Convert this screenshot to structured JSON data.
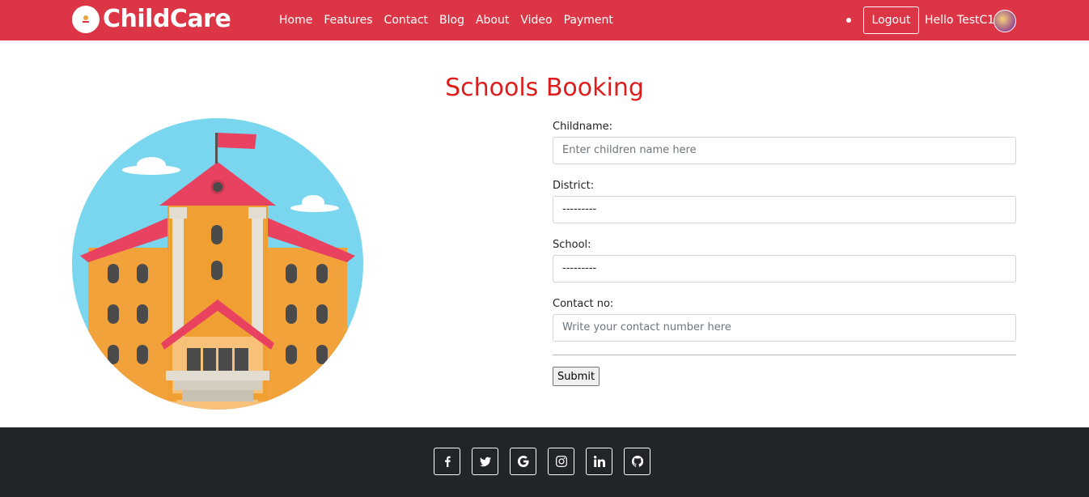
{
  "navbar": {
    "brand": "ChildCare",
    "links": [
      "Home",
      "Features",
      "Contact",
      "Blog",
      "About",
      "Video",
      "Payment"
    ],
    "logout_label": "Logout",
    "greeting": "Hello TestC1"
  },
  "main": {
    "title": "Schools Booking",
    "form": {
      "childname_label": "Childname:",
      "childname_placeholder": "Enter children name here",
      "district_label": "District:",
      "district_value": "---------",
      "school_label": "School:",
      "school_value": "---------",
      "contact_label": "Contact no:",
      "contact_placeholder": "Write your contact number here",
      "submit_label": "Submit"
    }
  },
  "footer": {
    "social_icons": [
      "facebook-icon",
      "twitter-icon",
      "google-icon",
      "instagram-icon",
      "linkedin-icon",
      "github-icon"
    ]
  },
  "colors": {
    "navbar_bg": "#dc3545",
    "title": "#dc1d1d",
    "footer_bg": "#212529"
  }
}
